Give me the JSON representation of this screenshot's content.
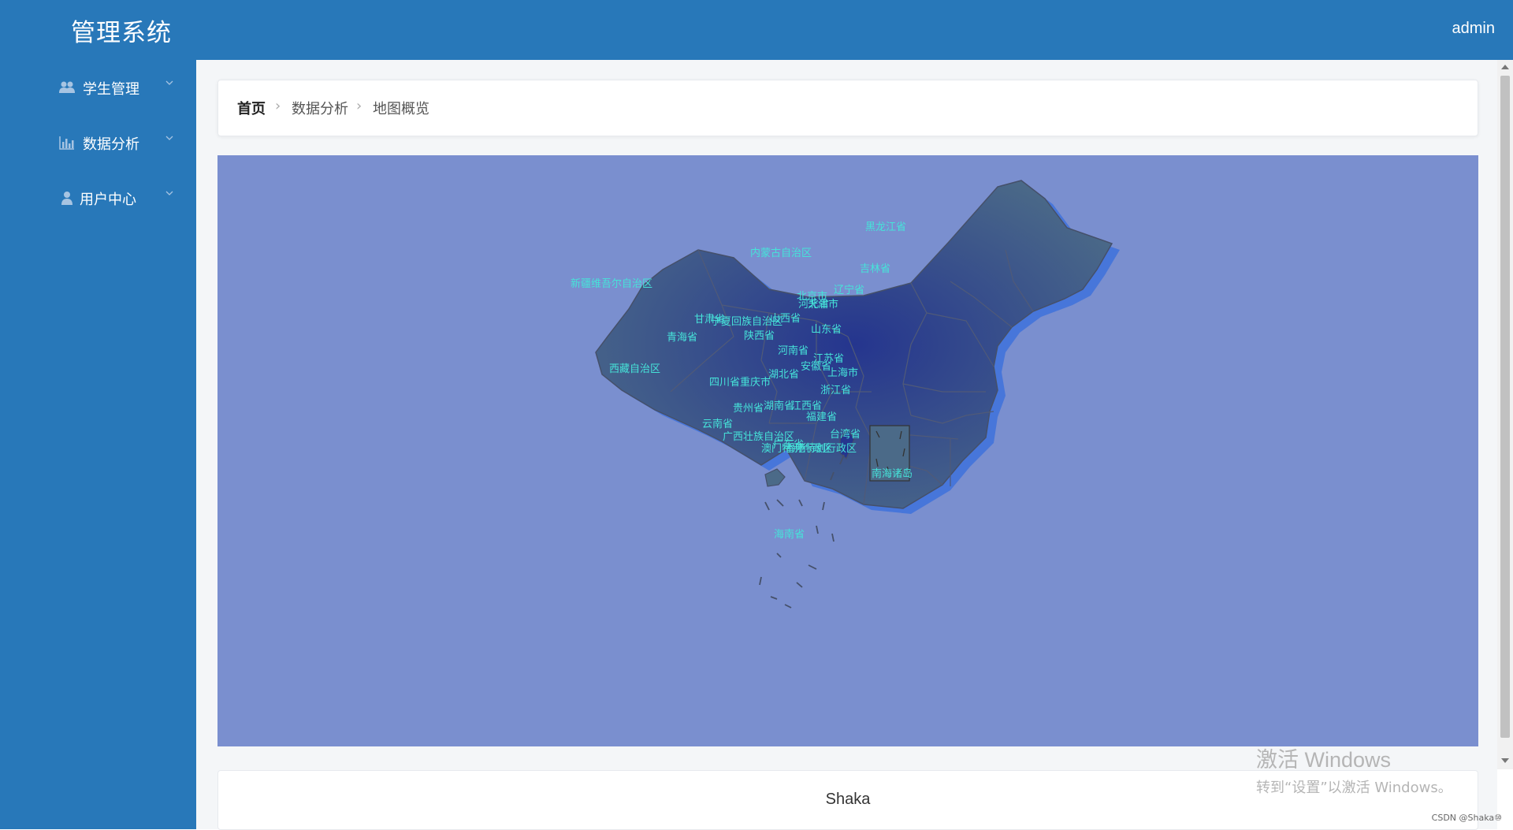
{
  "header": {
    "app_title": "管理系统",
    "user": "admin"
  },
  "sidebar": {
    "items": [
      {
        "label": "学生管理",
        "icon": "users-icon"
      },
      {
        "label": "数据分析",
        "icon": "bar-chart-icon"
      },
      {
        "label": "用户中心",
        "icon": "user-icon"
      }
    ]
  },
  "breadcrumb": [
    "首页",
    "数据分析",
    "地图概览"
  ],
  "map": {
    "background": "#7a8fcf",
    "region_fill": "#2b3f8f",
    "label_color": "#46e3d9",
    "labels": [
      "黑龙江省",
      "吉林省",
      "辽宁省",
      "内蒙古自治区",
      "新疆维吾尔自治区",
      "北京市",
      "天津市",
      "河北省",
      "甘肃省",
      "宁夏回族自治区",
      "山西省",
      "山东省",
      "青海省",
      "陕西省",
      "河南省",
      "江苏省",
      "安徽省",
      "上海市",
      "西藏自治区",
      "四川省",
      "重庆市",
      "湖北省",
      "浙江省",
      "贵州省",
      "湖南省",
      "江西省",
      "福建省",
      "云南省",
      "广西壮族自治区",
      "广东省",
      "台湾省",
      "香港特别行政区",
      "澳门特别行政区",
      "南海诸岛",
      "海南省"
    ]
  },
  "footer": {
    "text": "Shaka"
  },
  "watermark": {
    "line1": "激活 Windows",
    "line2": "转到“设置”以激活 Windows。"
  },
  "credit": "CSDN @Shaka⑩"
}
